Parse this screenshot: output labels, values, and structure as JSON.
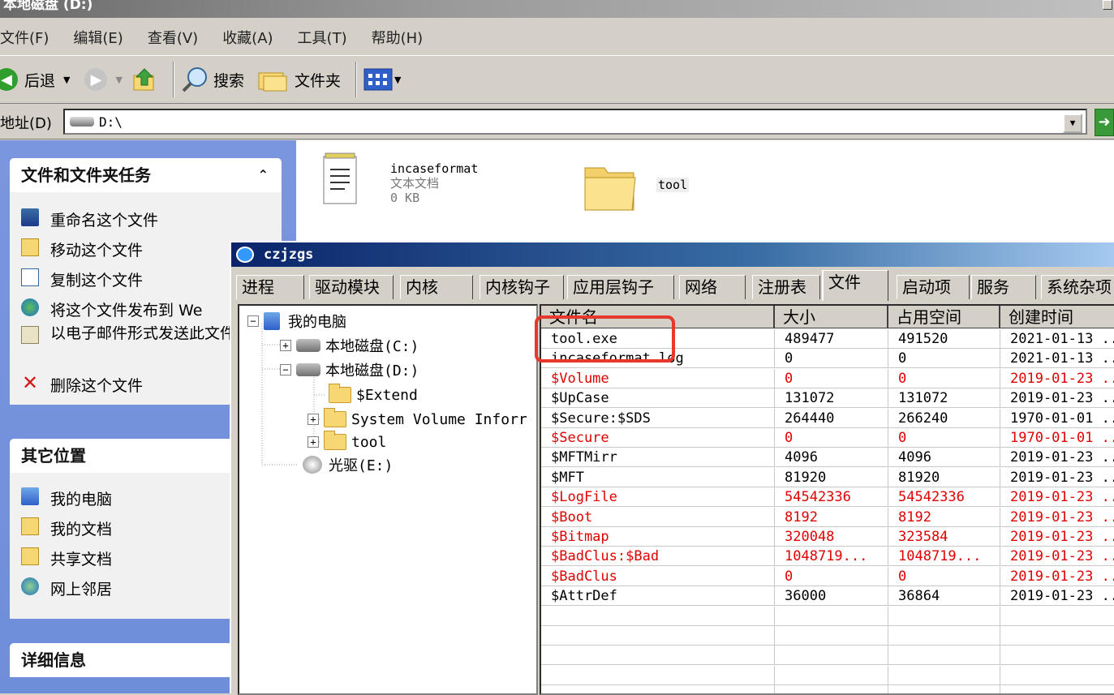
{
  "window": {
    "title": "本地磁盘 (D:)"
  },
  "menu": [
    "文件(F)",
    "编辑(E)",
    "查看(V)",
    "收藏(A)",
    "工具(T)",
    "帮助(H)"
  ],
  "toolbar": {
    "back": "后退",
    "search": "搜索",
    "folders": "文件夹"
  },
  "address": {
    "label": "地址(D)",
    "value": "D:\\"
  },
  "tasks_panel": {
    "title": "文件和文件夹任务",
    "items": [
      "重命名这个文件",
      "移动这个文件",
      "复制这个文件",
      "将这个文件发布到 We",
      "以电子邮件形式发送此文件",
      "删除这个文件"
    ]
  },
  "other_places": {
    "title": "其它位置",
    "items": [
      "我的电脑",
      "我的文档",
      "共享文档",
      "网上邻居"
    ]
  },
  "details": {
    "title": "详细信息"
  },
  "files": [
    {
      "name": "incaseformat",
      "type": "文本文档",
      "size": "0 KB"
    },
    {
      "name": "tool"
    }
  ],
  "dialog": {
    "title": "czjzgs",
    "tabs": [
      "进程",
      "驱动模块",
      "内核",
      "内核钩子",
      "应用层钩子",
      "网络",
      "注册表",
      "文件",
      "启动项",
      "服务",
      "系统杂项"
    ],
    "active_tab": "文件",
    "tree": [
      {
        "label": "我的电脑"
      },
      {
        "label": "本地磁盘(C:)"
      },
      {
        "label": "本地磁盘(D:)"
      },
      {
        "label": "$Extend"
      },
      {
        "label": "System Volume Inforr"
      },
      {
        "label": "tool"
      },
      {
        "label": "光驱(E:)"
      }
    ],
    "columns": [
      "文件名",
      "大小",
      "占用空间",
      "创建时间"
    ],
    "rows": [
      {
        "name": "tool.exe",
        "size": "489477",
        "alloc": "491520",
        "created": "2021-01-13 ..",
        "red": false
      },
      {
        "name": "incaseformat.log",
        "size": "0",
        "alloc": "0",
        "created": "2021-01-13 ..",
        "red": false
      },
      {
        "name": "$Volume",
        "size": "0",
        "alloc": "0",
        "created": "2019-01-23 ..",
        "red": true
      },
      {
        "name": "$UpCase",
        "size": "131072",
        "alloc": "131072",
        "created": "2019-01-23 ..",
        "red": false
      },
      {
        "name": "$Secure:$SDS",
        "size": "264440",
        "alloc": "266240",
        "created": "1970-01-01 ..",
        "red": false
      },
      {
        "name": "$Secure",
        "size": "0",
        "alloc": "0",
        "created": "1970-01-01 ..",
        "red": true
      },
      {
        "name": "$MFTMirr",
        "size": "4096",
        "alloc": "4096",
        "created": "2019-01-23 ..",
        "red": false
      },
      {
        "name": "$MFT",
        "size": "81920",
        "alloc": "81920",
        "created": "2019-01-23 ..",
        "red": false
      },
      {
        "name": "$LogFile",
        "size": "54542336",
        "alloc": "54542336",
        "created": "2019-01-23 ..",
        "red": true
      },
      {
        "name": "$Boot",
        "size": "8192",
        "alloc": "8192",
        "created": "2019-01-23 ..",
        "red": true
      },
      {
        "name": "$Bitmap",
        "size": "320048",
        "alloc": "323584",
        "created": "2019-01-23 ..",
        "red": true
      },
      {
        "name": "$BadClus:$Bad",
        "size": "1048719...",
        "alloc": "1048719...",
        "created": "2019-01-23 ..",
        "red": true
      },
      {
        "name": "$BadClus",
        "size": "0",
        "alloc": "0",
        "created": "2019-01-23 ..",
        "red": true
      },
      {
        "name": "$AttrDef",
        "size": "36000",
        "alloc": "36864",
        "created": "2019-01-23 ..",
        "red": false
      }
    ]
  },
  "colors": {
    "highlight_box": "#e8372c",
    "system_file_red": "#e00000",
    "title_blue": "#0a246a"
  }
}
